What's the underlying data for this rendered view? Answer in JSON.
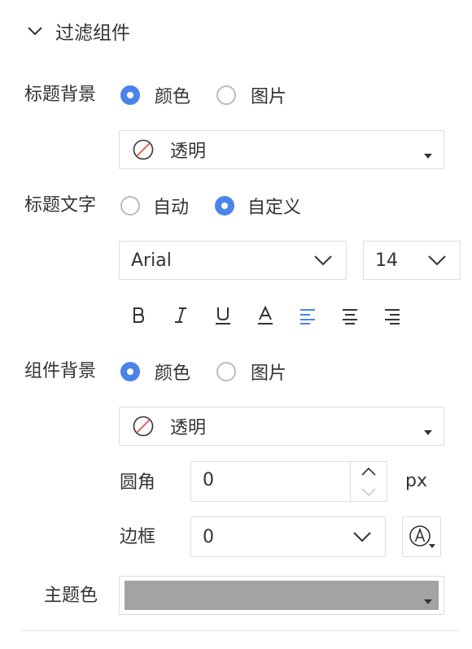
{
  "section": {
    "title": "过滤组件",
    "icon": "chevron-down-icon"
  },
  "title_background": {
    "label": "标题背景",
    "options": [
      "颜色",
      "图片"
    ],
    "selected": "颜色",
    "color_value": "透明"
  },
  "title_text": {
    "label": "标题文字",
    "options": [
      "自动",
      "自定义"
    ],
    "selected": "自定义",
    "font_family": "Arial",
    "font_size": "14",
    "format_icons": [
      "bold-icon",
      "italic-icon",
      "underline-icon",
      "font-color-icon",
      "align-left-icon",
      "align-center-icon",
      "align-right-icon"
    ],
    "active_format": "align-left-icon"
  },
  "component_background": {
    "label": "组件背景",
    "options": [
      "颜色",
      "图片"
    ],
    "selected": "颜色",
    "color_value": "透明"
  },
  "corner": {
    "label": "圆角",
    "value": "0",
    "unit": "px"
  },
  "border": {
    "label": "边框",
    "value": "0",
    "color_icon": "border-color-icon"
  },
  "theme_color": {
    "label": "主题色",
    "color": "#a3a3a3"
  },
  "colors": {
    "accent": "#4a84e8",
    "border": "#d9dde3",
    "no_color_slash": "#e5534b"
  }
}
